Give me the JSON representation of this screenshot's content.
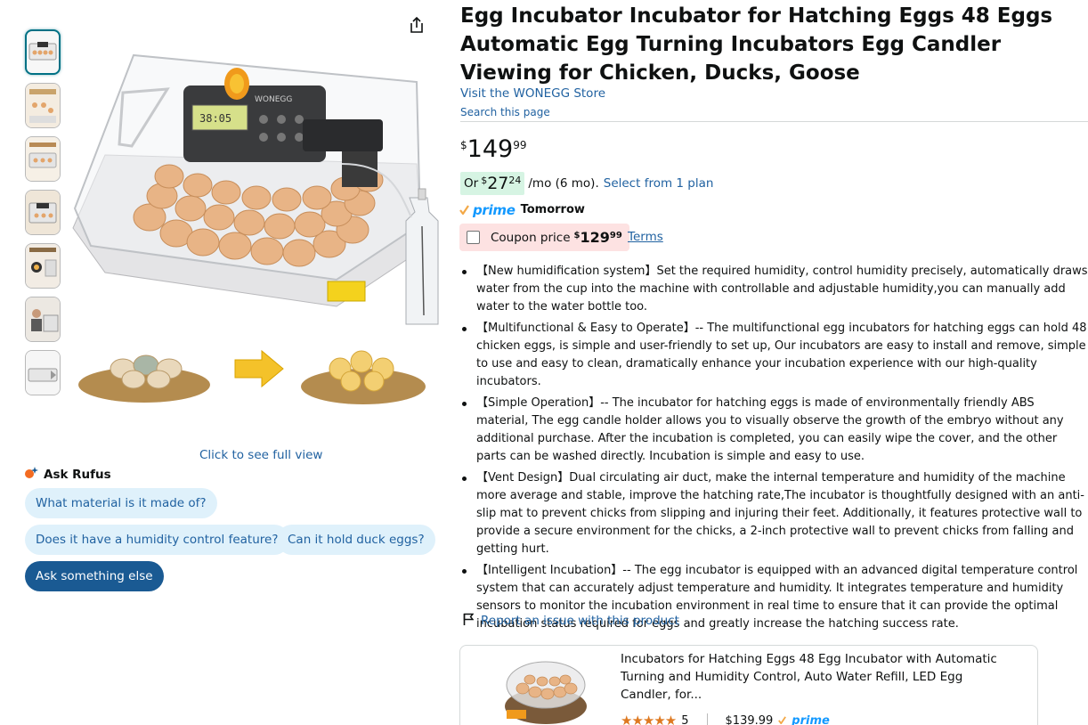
{
  "product": {
    "title": "Egg Incubator Incubator for Hatching Eggs 48 Eggs Automatic Egg Turning Incubators Egg Candler Viewing for Chicken, Ducks, Goose",
    "store_link": "Visit the WONEGG Store",
    "search_page": "Search this page"
  },
  "price": {
    "symbol": "$",
    "whole": "149",
    "fraction": "99"
  },
  "monthly": {
    "or": "Or",
    "symbol": "$",
    "whole": "27",
    "fraction": "24",
    "per": "/mo (6 mo).",
    "plan_link": "Select from 1 plan"
  },
  "delivery": {
    "prime": "prime",
    "day": "Tomorrow"
  },
  "coupon": {
    "label": "Coupon price",
    "symbol": "$",
    "whole": "129",
    "fraction": "99",
    "terms": "Terms"
  },
  "bullets": [
    "【New humidification system】Set the required humidity, control humidity precisely, automatically draws water from the cup into the machine with controllable and adjustable humidity,you can manually add water to the water bottle too.",
    "【Multifunctional & Easy to Operate】-- The multifunctional egg incubators for hatching eggs can hold 48 chicken eggs, is simple and user-friendly to set up, Our incubators are easy to install and remove, simple to use and easy to clean, dramatically enhance your incubation experience with our high-quality incubators.",
    "【Simple Operation】-- The incubator for hatching eggs is made of environmentally friendly ABS material, The egg candle holder allows you to visually observe the growth of the embryo without any additional purchase. After the incubation is completed, you can easily wipe the cover, and the other parts can be washed directly. Incubation is simple and easy to use.",
    "【Vent Design】Dual circulating air duct, make the internal temperature and humidity of the machine more average and stable, improve the hatching rate,The incubator is thoughtfully designed with an anti-slip mat to prevent chicks from slipping and injuring their feet. Additionally, it features protective wall to provide a secure environment for the chicks, a 2-inch protective wall to prevent chicks from falling and getting hurt.",
    "【Intelligent Incubation】-- The egg incubator is equipped with an advanced digital temperature control system that can accurately adjust temperature and humidity. It integrates temperature and humidity sensors to monitor the incubation environment in real time to ensure that it can provide the optimal incubation status required for eggs and greatly increase the hatching success rate."
  ],
  "report_link": "Report an issue with this product",
  "gallery": {
    "full_view": "Click to see full view",
    "image_brand_text": "WONEGG",
    "thumbnail_count": 7
  },
  "rufus": {
    "title": "Ask Rufus",
    "questions": [
      "What material is it made of?",
      "Does it have a humidity control feature?",
      "Can it hold duck eggs?"
    ],
    "ask_else": "Ask something else"
  },
  "sponsored": {
    "title": "Incubators for Hatching Eggs 48 Egg Incubator with Automatic Turning and Humidity Control, Auto Water Refill, LED Egg Candler, for...",
    "stars": "★★★★★",
    "rating_count": "5",
    "price": "$139.99",
    "prime": "prime"
  },
  "colors": {
    "link": "#2162a1",
    "prime": "#1399ff",
    "deal_green": "#d6f4e3",
    "coupon_bg": "#fde2e2",
    "rufus_chip": "#dff1fb",
    "rufus_dark": "#1a5a93",
    "star": "#de7921"
  }
}
